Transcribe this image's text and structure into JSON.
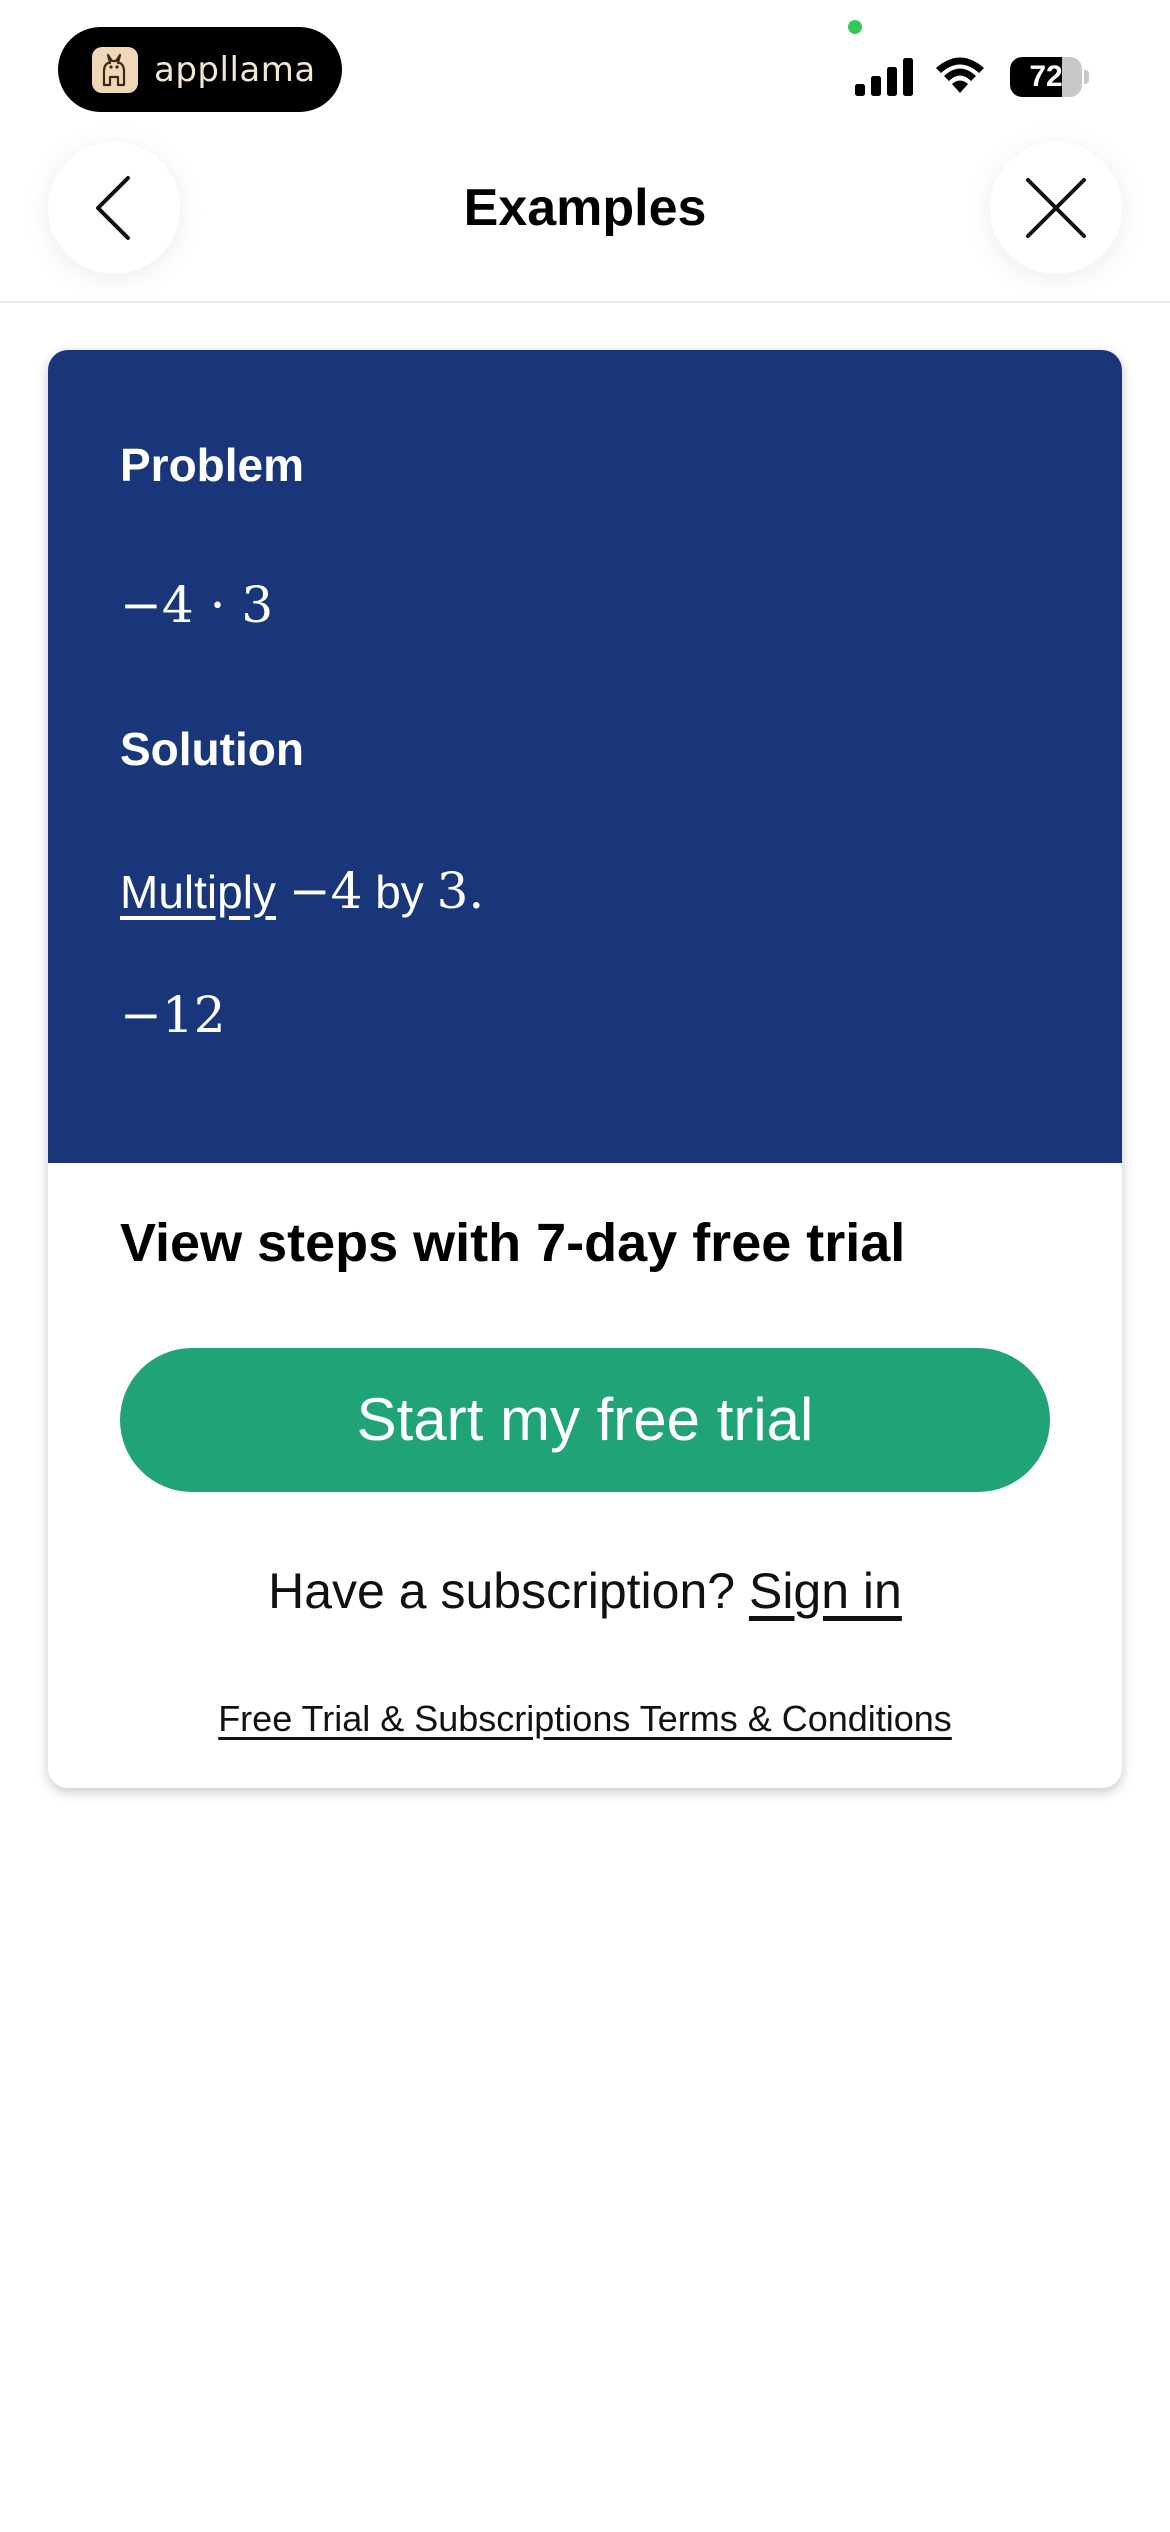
{
  "status_bar": {
    "app_name": "appllama",
    "battery_level": "72",
    "battery_fraction": 0.72
  },
  "header": {
    "title": "Examples"
  },
  "example": {
    "problem_label": "Problem",
    "problem_expression": "−4 · 3",
    "solution_label": "Solution",
    "solution_step": {
      "link_text": "Multiply",
      "operand_a": "−4",
      "connector": "by",
      "operand_b": "3",
      "terminal": "."
    },
    "result": "−12"
  },
  "paywall": {
    "heading": "View steps with 7-day free trial",
    "cta_label": "Start my free trial",
    "subscription_prompt": "Have a subscription?",
    "sign_in_label": "Sign in",
    "terms_label": "Free Trial & Subscriptions Terms & Conditions"
  },
  "colors": {
    "card_blue": "#1a367a",
    "cta_green": "#20a476",
    "status_dot": "#34c759"
  },
  "icons": {
    "back": "chevron-left-icon",
    "close": "close-icon",
    "signal": "cellular-signal-icon",
    "wifi": "wifi-icon",
    "battery": "battery-icon"
  }
}
